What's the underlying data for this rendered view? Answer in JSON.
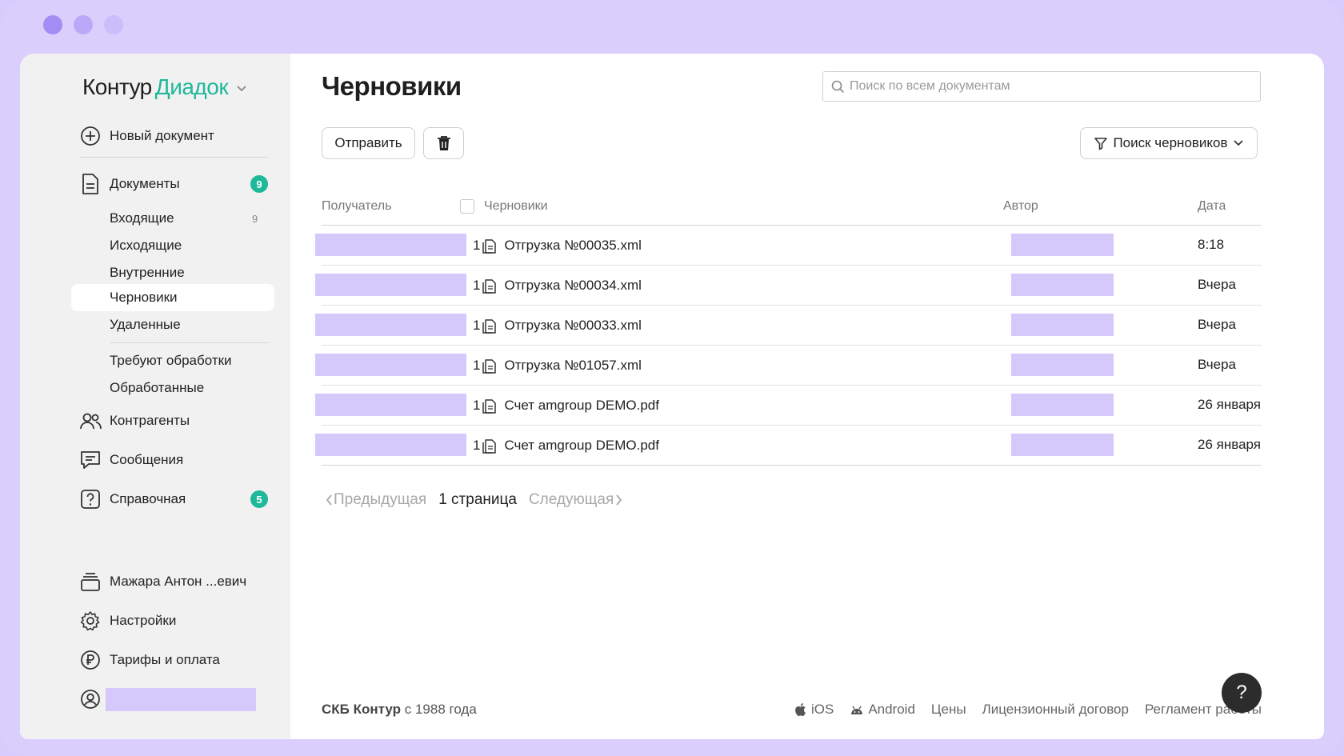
{
  "app": {
    "logo_part1": "Контур",
    "logo_part2": "Диадок",
    "accent_color": "#1fb89a",
    "highlight_color": "#d5c9fb"
  },
  "sidebar": {
    "new_document": "Новый документ",
    "documents": {
      "label": "Документы",
      "badge": "9"
    },
    "folders": [
      {
        "label": "Входящие",
        "count": "9"
      },
      {
        "label": "Исходящие"
      },
      {
        "label": "Внутренние"
      },
      {
        "label": "Черновики",
        "active": true
      },
      {
        "label": "Удаленные"
      }
    ],
    "status_folders": [
      {
        "label": "Требуют обработки"
      },
      {
        "label": "Обработанные"
      }
    ],
    "contractors": "Контрагенты",
    "messages": "Сообщения",
    "help": {
      "label": "Справочная",
      "badge": "5"
    },
    "user": "Мажара Антон ...евич",
    "settings": "Настройки",
    "tariffs": "Тарифы и оплата"
  },
  "main": {
    "title": "Черновики",
    "search_placeholder": "Поиск по всем документам",
    "send_button": "Отправить",
    "filter_button": "Поиск черновиков",
    "columns": {
      "recipient": "Получатель",
      "drafts": "Черновики",
      "author": "Автор",
      "date": "Дата"
    },
    "rows": [
      {
        "count": "1",
        "name": "Отгрузка №00035.xml",
        "date": "8:18"
      },
      {
        "count": "1",
        "name": "Отгрузка №00034.xml",
        "date": "Вчера"
      },
      {
        "count": "1",
        "name": "Отгрузка №00033.xml",
        "date": "Вчера"
      },
      {
        "count": "1",
        "name": "Отгрузка №01057.xml",
        "date": "Вчера"
      },
      {
        "count": "1",
        "name": "Счет amgroup DEMO.pdf",
        "date": "26 января"
      },
      {
        "count": "1",
        "name": "Счет amgroup DEMO.pdf",
        "date": "26 января"
      }
    ],
    "pager": {
      "prev": "Предыдущая",
      "current": "1 страница",
      "next": "Следующая"
    }
  },
  "footer": {
    "company": "СКБ Контур",
    "since": "с 1988 года",
    "links": [
      "iOS",
      "Android",
      "Цены",
      "Лицензионный договор",
      "Регламент работы"
    ],
    "help_button": "?"
  }
}
